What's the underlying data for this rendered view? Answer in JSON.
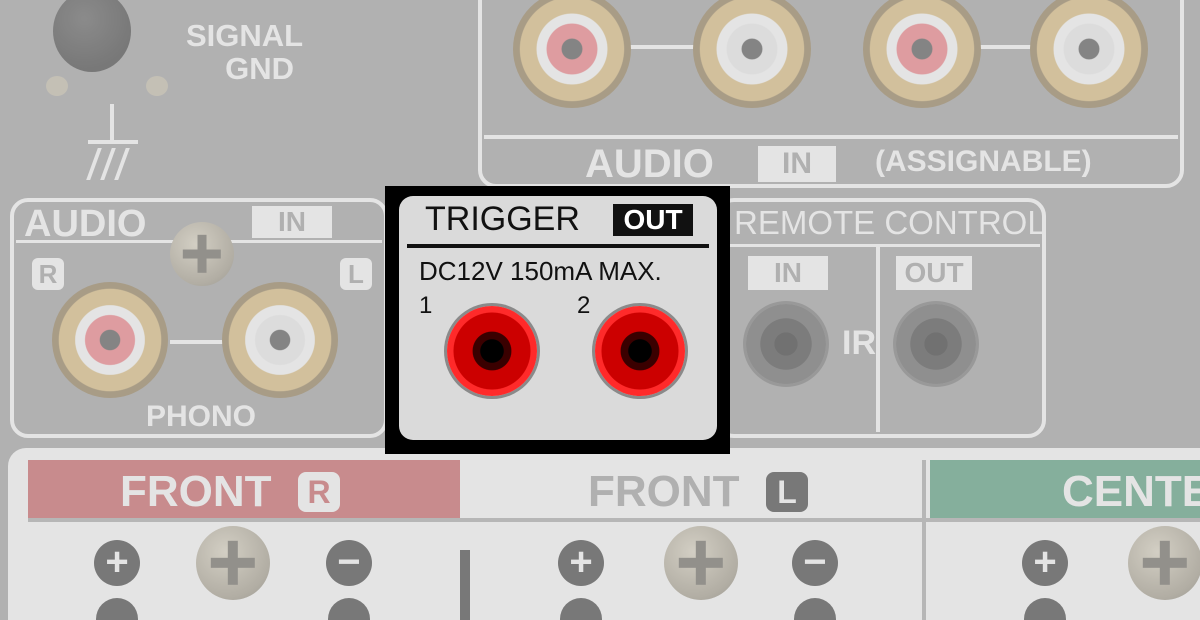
{
  "ground": {
    "label_line1": "SIGNAL",
    "label_line2": "GND"
  },
  "assignable": {
    "audio_label": "AUDIO",
    "in_tag": "IN",
    "note": "(ASSIGNABLE)"
  },
  "phono": {
    "audio_label": "AUDIO",
    "in_tag": "IN",
    "r_tag": "R",
    "l_tag": "L",
    "name": "PHONO"
  },
  "trigger": {
    "title": "TRIGGER",
    "out_tag": "OUT",
    "spec": "DC12V 150mA MAX.",
    "jack1": "1",
    "jack2": "2"
  },
  "remote": {
    "title": "REMOTE CONTROL",
    "in_tag": "IN",
    "out_tag": "OUT",
    "ir_label": "IR"
  },
  "speakers": {
    "front_r": {
      "label": "FRONT",
      "side": "R"
    },
    "front_l": {
      "label": "FRONT",
      "side": "L"
    },
    "center": {
      "label": "CENTE"
    },
    "plus": "+",
    "minus": "−"
  },
  "colors": {
    "trigger_red": "#e01515",
    "front_r_band": "#c23a3e",
    "center_band": "#2e8a5f"
  }
}
